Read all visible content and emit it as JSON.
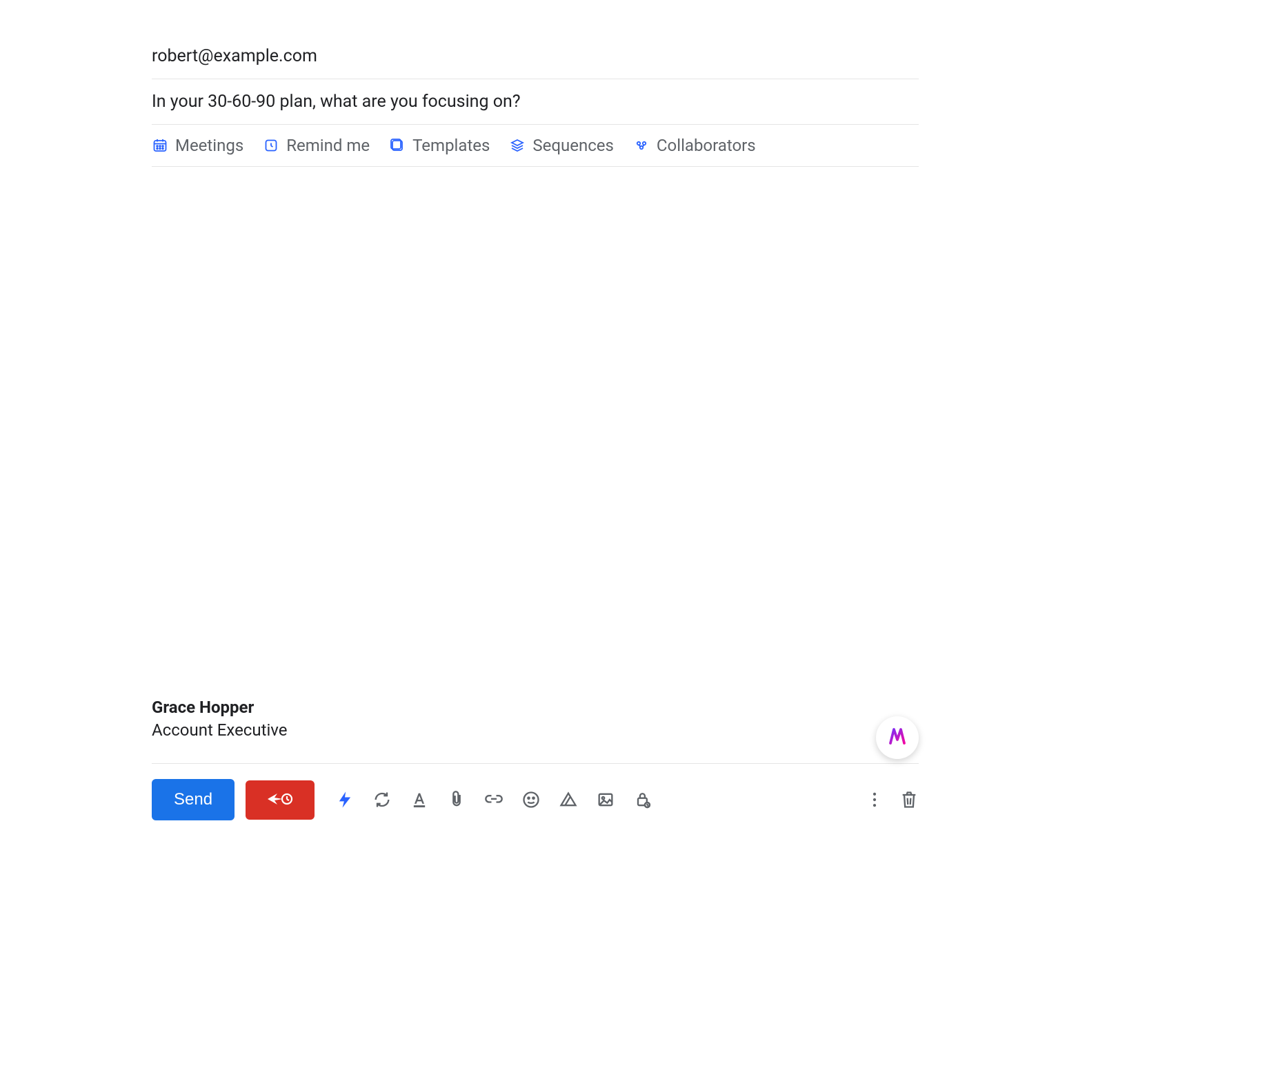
{
  "compose": {
    "to": "robert@example.com",
    "subject": "In your 30-60-90 plan, what are you focusing on?"
  },
  "toolbar": {
    "meetings": "Meetings",
    "remind": "Remind me",
    "templates": "Templates",
    "sequences": "Sequences",
    "collaborators": "Collaborators"
  },
  "signature": {
    "name": "Grace Hopper",
    "title": "Account Executive"
  },
  "bottom": {
    "send": "Send"
  }
}
